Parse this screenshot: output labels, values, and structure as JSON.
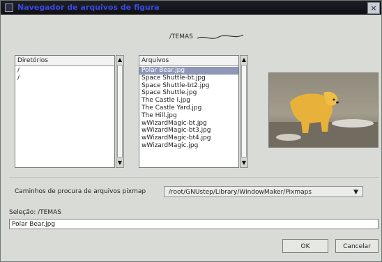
{
  "window": {
    "title": "Navegador de arquivos de figura",
    "close_glyph": "×"
  },
  "path": {
    "value": "/TEMAS"
  },
  "directories": {
    "header": "Diretórios",
    "items": [
      "/",
      "/"
    ]
  },
  "files": {
    "header": "Arquivos",
    "items": [
      "Polar Bear.jpg",
      "Space Shuttle-bt.jpg",
      "Space Shuttle-bt2.jpg",
      "Space Shuttle.jpg",
      "The Castle I.jpg",
      "The Castle Yard.jpg",
      "The Hill.jpg",
      "wWizardMagic-bt.jpg",
      "wWizardMagic-bt3.jpg",
      "wWizardMagic-bt4.jpg",
      "wWizardMagic.jpg"
    ],
    "selected_index": 0
  },
  "pixmap": {
    "label": "Caminhos de procura de arquivos pixmap",
    "value": "/root/GNUstep/Library/WindowMaker/Pixmaps"
  },
  "selection": {
    "label": "Seleção: /TEMAS",
    "value": "Polar Bear.jpg"
  },
  "buttons": {
    "ok": "OK",
    "cancel": "Cancelar"
  },
  "icons": {
    "scroll_up": "▲",
    "scroll_down": "▼",
    "dropdown": "▼"
  },
  "colors": {
    "titlebar": "#111217",
    "title_text": "#3b4ae0",
    "selection": "#8f97b8",
    "background": "#d9dcd6"
  }
}
